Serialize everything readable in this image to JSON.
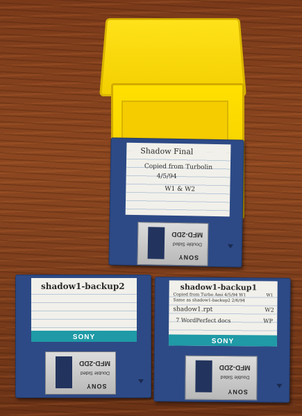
{
  "disks": [
    {
      "id": "disk-top",
      "brand": "SONY",
      "model": "MFD-2DD",
      "spec": "Double Sided",
      "label_lines": [
        "Shadow Final",
        "Copied from Turbolin",
        "4/5/94",
        "W1 & W2"
      ]
    },
    {
      "id": "disk-left",
      "brand": "SONY",
      "model": "MFD-2DD",
      "spec": "Double Sided",
      "label_lines": [
        "shadow1-backup2"
      ]
    },
    {
      "id": "disk-right",
      "brand": "SONY",
      "model": "MFD-2DD",
      "spec": "Double Sided",
      "label_lines": [
        "shadow1-backup1",
        "Copied from Turbo Ami 4/5/94 W1",
        "Same as shadow1-backup2 2/6/94",
        "shadow1.rpt",
        "7 WordPerfect docs"
      ],
      "label_side_notes": [
        "W1",
        "W2",
        "WP"
      ]
    }
  ],
  "colors": {
    "floppy": "#2d4a86",
    "label_band": "#1f9aa6",
    "box": "#ffe000",
    "wood": "#7a3a1a"
  }
}
